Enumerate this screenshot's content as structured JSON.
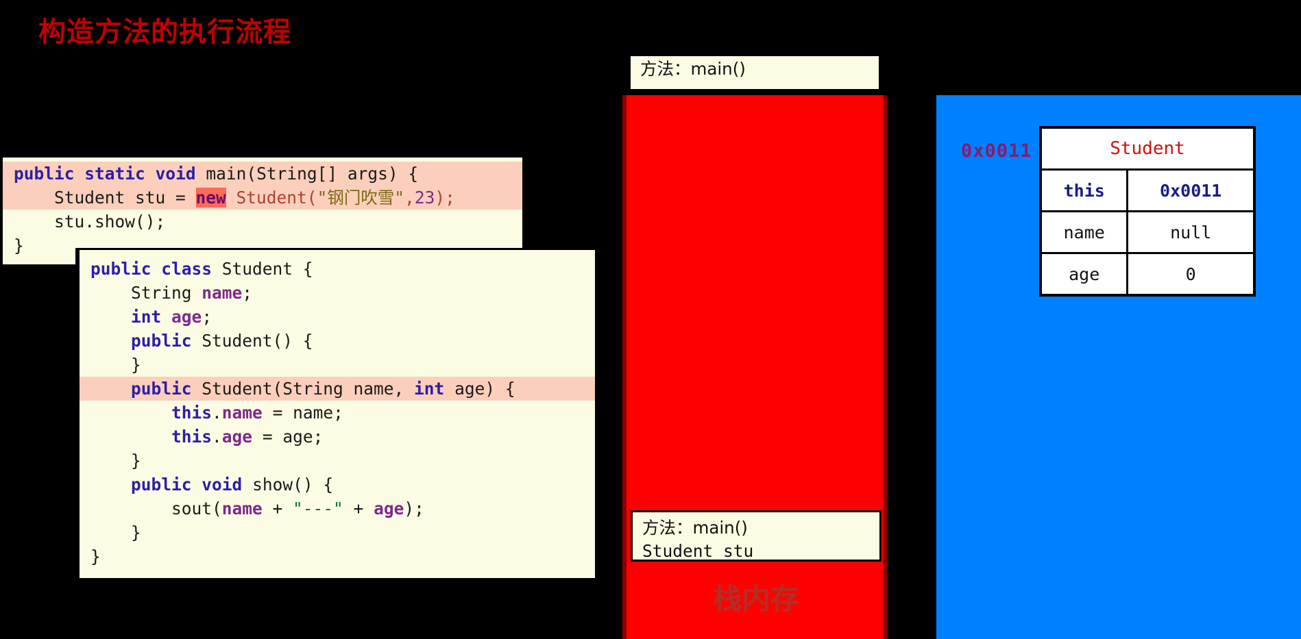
{
  "title": "构造方法的执行流程",
  "colors": {
    "title": "#c00000",
    "stack": "#fe0000",
    "heap": "#0080fe",
    "code_bg": "#fcfce4",
    "highlight": "#fbcfbb",
    "highlight_strong": "#fb8d7d",
    "keyword": "#2c1ea8",
    "field": "#7d2a8a",
    "address": "#8b1a6b"
  },
  "main_code": {
    "name": "main-method-code",
    "lines": [
      {
        "highlight": "line",
        "tokens": [
          {
            "t": "public",
            "c": "kw"
          },
          {
            "t": " ",
            "c": "plain"
          },
          {
            "t": "static",
            "c": "kw"
          },
          {
            "t": " ",
            "c": "plain"
          },
          {
            "t": "void",
            "c": "kw"
          },
          {
            "t": " main(String[] args) {",
            "c": "plain"
          }
        ]
      },
      {
        "highlight": "line",
        "tokens": [
          {
            "t": "    Student stu = ",
            "c": "plain"
          },
          {
            "t": "new",
            "c": "newkw"
          },
          {
            "t": " ",
            "c": "plain"
          },
          {
            "t": "Student(",
            "c": "redtxt"
          },
          {
            "t": "\"钢门吹雪\"",
            "c": "str"
          },
          {
            "t": ",",
            "c": "redtxt"
          },
          {
            "t": "23",
            "c": "num"
          },
          {
            "t": ");",
            "c": "redtxt"
          }
        ]
      },
      {
        "highlight": "",
        "tokens": [
          {
            "t": "    stu.show();",
            "c": "plain"
          }
        ]
      },
      {
        "highlight": "",
        "tokens": [
          {
            "t": "}",
            "c": "plain"
          }
        ]
      }
    ]
  },
  "student_code": {
    "name": "student-class-code",
    "lines": [
      {
        "highlight": "",
        "tokens": [
          {
            "t": "public",
            "c": "kw"
          },
          {
            "t": " ",
            "c": "plain"
          },
          {
            "t": "class",
            "c": "kw"
          },
          {
            "t": " Student {",
            "c": "plain"
          }
        ]
      },
      {
        "highlight": "",
        "tokens": [
          {
            "t": "    String ",
            "c": "plain"
          },
          {
            "t": "name",
            "c": "fld"
          },
          {
            "t": ";",
            "c": "plain"
          }
        ]
      },
      {
        "highlight": "",
        "tokens": [
          {
            "t": "    ",
            "c": "plain"
          },
          {
            "t": "int",
            "c": "kw"
          },
          {
            "t": " ",
            "c": "plain"
          },
          {
            "t": "age",
            "c": "fld"
          },
          {
            "t": ";",
            "c": "plain"
          }
        ]
      },
      {
        "highlight": "",
        "tokens": [
          {
            "t": "    ",
            "c": "plain"
          },
          {
            "t": "public",
            "c": "kw"
          },
          {
            "t": " Student() {",
            "c": "plain"
          }
        ]
      },
      {
        "highlight": "",
        "tokens": [
          {
            "t": "    }",
            "c": "plain"
          }
        ]
      },
      {
        "highlight": "line",
        "tokens": [
          {
            "t": "    ",
            "c": "plain"
          },
          {
            "t": "public",
            "c": "kw"
          },
          {
            "t": " Student(String name, ",
            "c": "plain"
          },
          {
            "t": "int",
            "c": "kw"
          },
          {
            "t": " age) {",
            "c": "plain"
          }
        ]
      },
      {
        "highlight": "",
        "tokens": [
          {
            "t": "        ",
            "c": "plain"
          },
          {
            "t": "this",
            "c": "kw"
          },
          {
            "t": ".",
            "c": "plain"
          },
          {
            "t": "name",
            "c": "fld"
          },
          {
            "t": " = name;",
            "c": "plain"
          }
        ]
      },
      {
        "highlight": "",
        "tokens": [
          {
            "t": "        ",
            "c": "plain"
          },
          {
            "t": "this",
            "c": "kw"
          },
          {
            "t": ".",
            "c": "plain"
          },
          {
            "t": "age",
            "c": "fld"
          },
          {
            "t": " = age;",
            "c": "plain"
          }
        ]
      },
      {
        "highlight": "",
        "tokens": [
          {
            "t": "    }",
            "c": "plain"
          }
        ]
      },
      {
        "highlight": "",
        "tokens": [
          {
            "t": "    ",
            "c": "plain"
          },
          {
            "t": "public",
            "c": "kw"
          },
          {
            "t": " ",
            "c": "plain"
          },
          {
            "t": "void",
            "c": "kw"
          },
          {
            "t": " show() {",
            "c": "plain"
          }
        ]
      },
      {
        "highlight": "",
        "tokens": [
          {
            "t": "        sout(",
            "c": "plain"
          },
          {
            "t": "name",
            "c": "fld"
          },
          {
            "t": " + ",
            "c": "plain"
          },
          {
            "t": "\"---\"",
            "c": "strg"
          },
          {
            "t": " + ",
            "c": "plain"
          },
          {
            "t": "age",
            "c": "fld"
          },
          {
            "t": ");",
            "c": "plain"
          }
        ]
      },
      {
        "highlight": "",
        "tokens": [
          {
            "t": "    }",
            "c": "plain"
          }
        ]
      },
      {
        "highlight": "",
        "tokens": [
          {
            "t": "}",
            "c": "plain"
          }
        ]
      }
    ]
  },
  "stack": {
    "label": "栈内存",
    "top_frame": "方法：main()",
    "bottom_frame": {
      "title": "方法：main()",
      "variable": "Student  stu"
    }
  },
  "heap": {
    "address": "0x0011",
    "object": {
      "class_name": "Student",
      "rows": [
        {
          "field": "this",
          "value": "0x0011",
          "bold": true
        },
        {
          "field": "name",
          "value": "null",
          "bold": false
        },
        {
          "field": "age",
          "value": "0",
          "bold": false
        }
      ]
    }
  }
}
